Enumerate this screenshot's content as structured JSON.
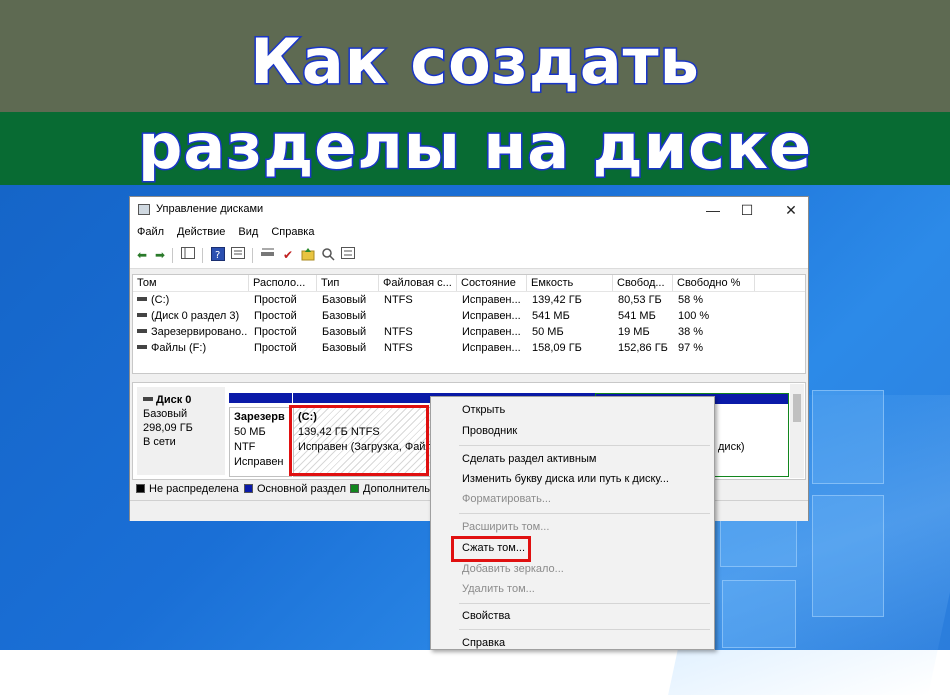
{
  "banner": {
    "line1": "Как создать",
    "line2": "разделы на диске"
  },
  "window": {
    "title": "Управление дисками",
    "controls": {
      "minimize": "—",
      "maximize": "☐",
      "close": "✕"
    },
    "menu": [
      "Файл",
      "Действие",
      "Вид",
      "Справка"
    ]
  },
  "volumes": {
    "headers": [
      "Том",
      "Располо...",
      "Тип",
      "Файловая с...",
      "Состояние",
      "Емкость",
      "Свобод...",
      "Свободно %"
    ],
    "rows": [
      {
        "name": "(C:)",
        "layout": "Простой",
        "type": "Базовый",
        "fs": "NTFS",
        "status": "Исправен...",
        "capacity": "139,42 ГБ",
        "free": "80,53 ГБ",
        "free_pct": "58 %"
      },
      {
        "name": "(Диск 0 раздел 3)",
        "layout": "Простой",
        "type": "Базовый",
        "fs": "",
        "status": "Исправен...",
        "capacity": "541 МБ",
        "free": "541 МБ",
        "free_pct": "100 %"
      },
      {
        "name": "Зарезервировано...",
        "layout": "Простой",
        "type": "Базовый",
        "fs": "NTFS",
        "status": "Исправен...",
        "capacity": "50 МБ",
        "free": "19 МБ",
        "free_pct": "38 %"
      },
      {
        "name": "Файлы (F:)",
        "layout": "Простой",
        "type": "Базовый",
        "fs": "NTFS",
        "status": "Исправен...",
        "capacity": "158,09 ГБ",
        "free": "152,86 ГБ",
        "free_pct": "97 %"
      }
    ]
  },
  "disk": {
    "name": "Диск 0",
    "type": "Базовый",
    "size": "298,09 ГБ",
    "status": "В сети",
    "partitions": [
      {
        "label": "Зарезерв",
        "size": "50 МБ NTF",
        "status": "Исправен"
      },
      {
        "label": "(C:)",
        "size": "139,42 ГБ NTFS",
        "status": "Исправен (Загрузка, Файл"
      },
      {
        "label": "",
        "size": "",
        "status": "диск)"
      }
    ]
  },
  "legend": [
    {
      "label": "Не распределена",
      "color": "#000000"
    },
    {
      "label": "Основной раздел",
      "color": "#0a1aa8"
    },
    {
      "label": "Дополнительн",
      "color": "#12861e"
    }
  ],
  "context_menu": {
    "items": [
      {
        "label": "Открыть",
        "enabled": true
      },
      {
        "label": "Проводник",
        "enabled": true
      },
      {
        "label": "Сделать раздел активным",
        "enabled": true
      },
      {
        "label": "Изменить букву диска или путь к диску...",
        "enabled": true
      },
      {
        "label": "Форматировать...",
        "enabled": false
      },
      {
        "label": "Расширить том...",
        "enabled": false
      },
      {
        "label": "Сжать том...",
        "enabled": true
      },
      {
        "label": "Добавить зеркало...",
        "enabled": false
      },
      {
        "label": "Удалить том...",
        "enabled": false
      },
      {
        "label": "Свойства",
        "enabled": true
      },
      {
        "label": "Справка",
        "enabled": true
      }
    ]
  },
  "colors": {
    "highlight": "#e01010",
    "primary_partition": "#0a1aa8",
    "banner_top": "#5e6a52",
    "banner_bottom": "#086b33"
  }
}
